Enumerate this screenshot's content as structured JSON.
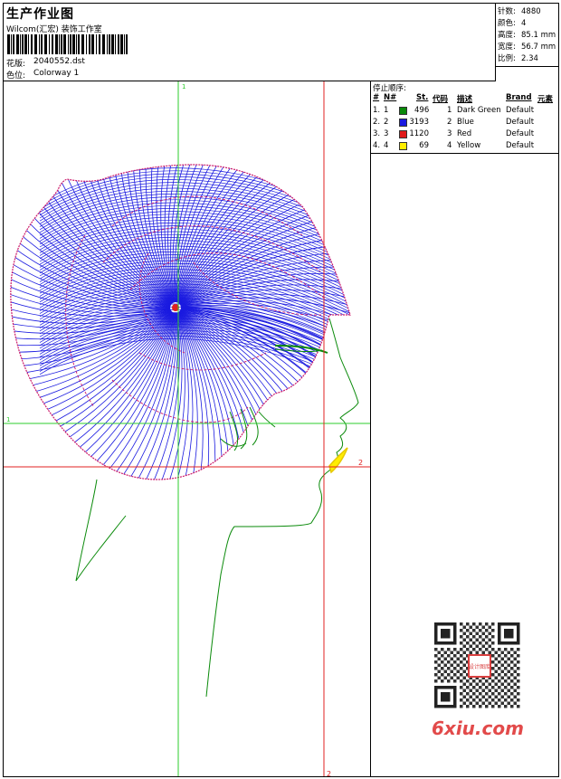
{
  "header": {
    "title": "生产作业图",
    "company": "Wilcom(汇宏) 装饰工作室",
    "design_label": "花版:",
    "design_file": "2040552.dst",
    "colorway_label": "色位:",
    "colorway": "Colorway 1"
  },
  "stats": [
    {
      "key": "针数:",
      "value": "4880"
    },
    {
      "key": "颜色:",
      "value": "4"
    },
    {
      "key": "高度:",
      "value": "85.1 mm"
    },
    {
      "key": "宽度:",
      "value": "56.7 mm"
    },
    {
      "key": "比例:",
      "value": "2.34"
    }
  ],
  "thread_table": {
    "title": "停止顺序:",
    "headers": {
      "n": "#",
      "no": "N#",
      "st": "St.",
      "code": "代码",
      "desc": "描述",
      "brand": "Brand",
      "elem": "元素"
    },
    "rows": [
      {
        "n": "1.",
        "no": "1",
        "color": "#0a8a0a",
        "st": "496",
        "code": "1",
        "desc": "Dark Green",
        "brand": "Default"
      },
      {
        "n": "2.",
        "no": "2",
        "color": "#1a1ae0",
        "st": "3193",
        "code": "2",
        "desc": "Blue",
        "brand": "Default"
      },
      {
        "n": "3.",
        "no": "3",
        "color": "#e01a1a",
        "st": "1120",
        "code": "3",
        "desc": "Red",
        "brand": "Default"
      },
      {
        "n": "4.",
        "no": "4",
        "color": "#ffee00",
        "st": "69",
        "code": "4",
        "desc": "Yellow",
        "brand": "Default"
      }
    ]
  },
  "design_view": {
    "axis_labels": {
      "v1": "1",
      "h1": "1",
      "v2": "2",
      "h2": "2"
    },
    "colors": {
      "axis1": "#2ecc2e",
      "axis2": "#e02020",
      "hair": "#1a1ae0",
      "hair_accent": "#cc1a6a",
      "outline": "#0a8a0a",
      "lips": "#ffee00"
    }
  },
  "watermark": {
    "text": "6xiu.com",
    "seal": "设计图库"
  }
}
